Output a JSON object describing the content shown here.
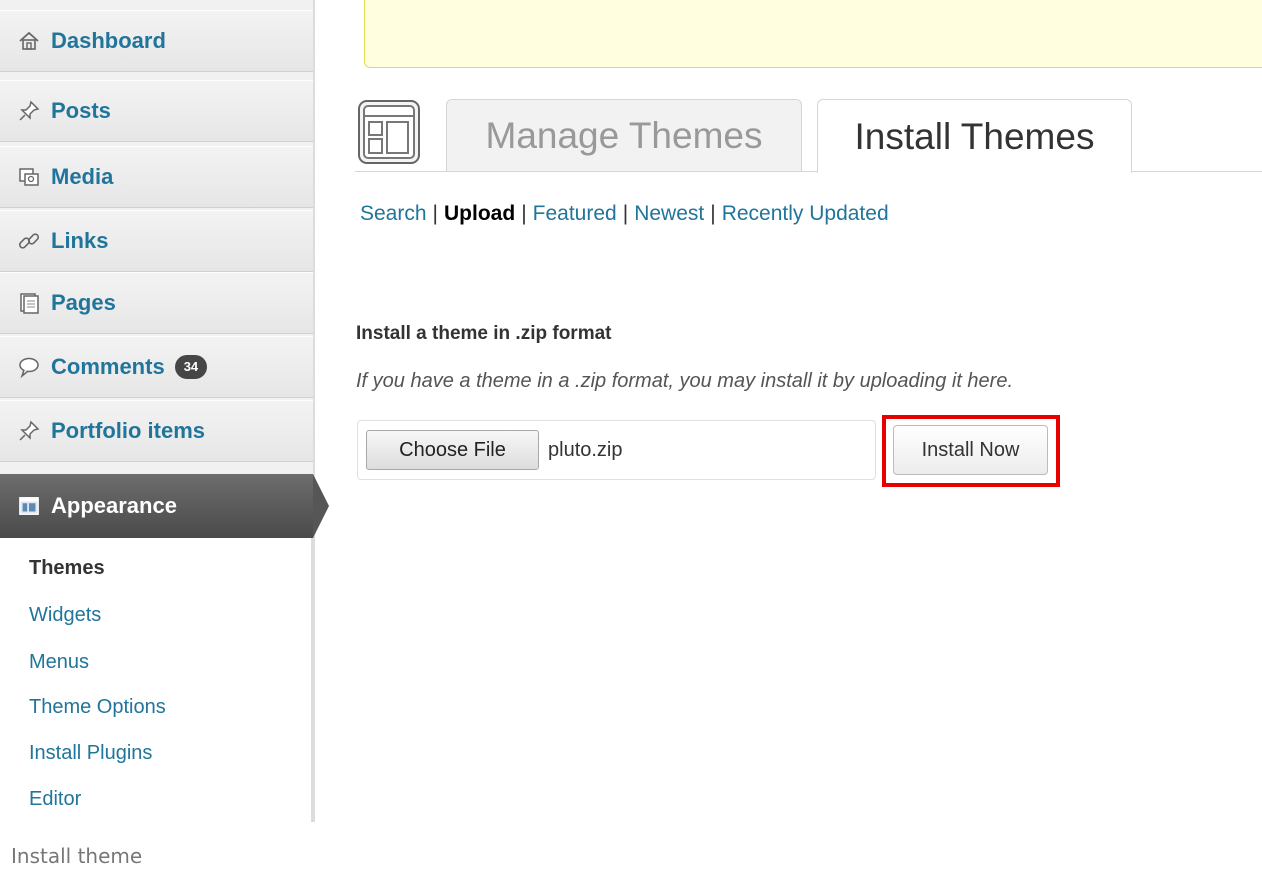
{
  "sidebar": {
    "items": [
      {
        "label": "Dashboard",
        "icon": "home-icon"
      },
      {
        "label": "Posts",
        "icon": "pushpin-icon"
      },
      {
        "label": "Media",
        "icon": "media-icon"
      },
      {
        "label": "Links",
        "icon": "link-icon"
      },
      {
        "label": "Pages",
        "icon": "pages-icon"
      },
      {
        "label": "Comments",
        "icon": "comment-icon",
        "badge": "34"
      },
      {
        "label": "Portfolio items",
        "icon": "pushpin-icon"
      }
    ],
    "active": {
      "label": "Appearance",
      "icon": "appearance-icon"
    },
    "submenu": [
      {
        "label": "Themes",
        "current": true
      },
      {
        "label": "Widgets"
      },
      {
        "label": "Menus"
      },
      {
        "label": "Theme Options"
      },
      {
        "label": "Install Plugins"
      },
      {
        "label": "Editor"
      }
    ]
  },
  "tabs": {
    "manage": "Manage Themes",
    "install": "Install Themes"
  },
  "subnav": {
    "search": "Search",
    "upload": "Upload",
    "featured": "Featured",
    "newest": "Newest",
    "recently_updated": "Recently Updated",
    "separator": "|"
  },
  "upload_form": {
    "heading": "Install a theme in .zip format",
    "description": "If you have a theme in a .zip format, you may install it by uploading it here.",
    "choose_file_label": "Choose File",
    "file_name": "pluto.zip",
    "install_button": "Install Now"
  },
  "caption": "Install theme",
  "colors": {
    "link": "#21759b",
    "highlight": "#e80000",
    "notice_bg": "#ffffe0"
  }
}
